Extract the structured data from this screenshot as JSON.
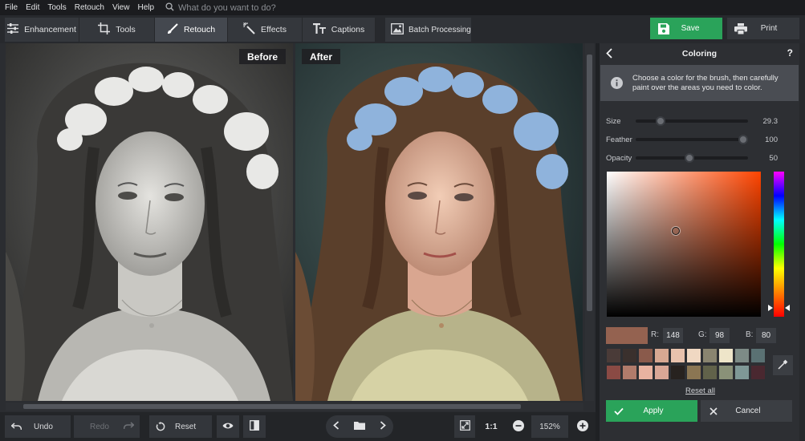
{
  "menu": {
    "items": [
      "File",
      "Edit",
      "Tools",
      "Retouch",
      "View",
      "Help"
    ],
    "search_placeholder": "What do you want to do?"
  },
  "toolbar": {
    "tabs": [
      {
        "label": "Enhancement",
        "icon": "sliders-icon"
      },
      {
        "label": "Tools",
        "icon": "crop-icon"
      },
      {
        "label": "Retouch",
        "icon": "brush-icon",
        "active": true
      },
      {
        "label": "Effects",
        "icon": "magic-wand-icon"
      },
      {
        "label": "Captions",
        "icon": "text-icon"
      }
    ],
    "batch_label": "Batch Processing",
    "save_label": "Save",
    "print_label": "Print"
  },
  "canvas": {
    "before_label": "Before",
    "after_label": "After"
  },
  "bottom": {
    "undo_label": "Undo",
    "redo_label": "Redo",
    "reset_label": "Reset",
    "one_to_one": "1:1",
    "zoom": "152%"
  },
  "panel": {
    "title": "Coloring",
    "help": "?",
    "info": "Choose a color for the brush, then carefully paint over the areas you need to color.",
    "sliders": [
      {
        "label": "Size",
        "value": "29.3",
        "fraction": 0.22
      },
      {
        "label": "Feather",
        "value": "100",
        "fraction": 0.96
      },
      {
        "label": "Opacity",
        "value": "50",
        "fraction": 0.48
      }
    ],
    "rgb": {
      "r_label": "R:",
      "r": "148",
      "g_label": "G:",
      "g": "98",
      "b_label": "B:",
      "b": "80"
    },
    "current_color": "#946250",
    "swatches": [
      "#4a3b38",
      "#3a302d",
      "#8a5a4b",
      "#d7a892",
      "#e8c2ad",
      "#f0d8c2",
      "#8a8570",
      "#eee5c9",
      "#7d8b86",
      "#5a7173",
      "#8a4a44",
      "#b07b6b",
      "#e9b3a0",
      "#d9a796",
      "#27221f",
      "#8b7653",
      "#61624a",
      "#8a9178",
      "#7f9896",
      "#4a2830"
    ],
    "reset_all_label": "Reset all",
    "apply_label": "Apply",
    "cancel_label": "Cancel"
  }
}
